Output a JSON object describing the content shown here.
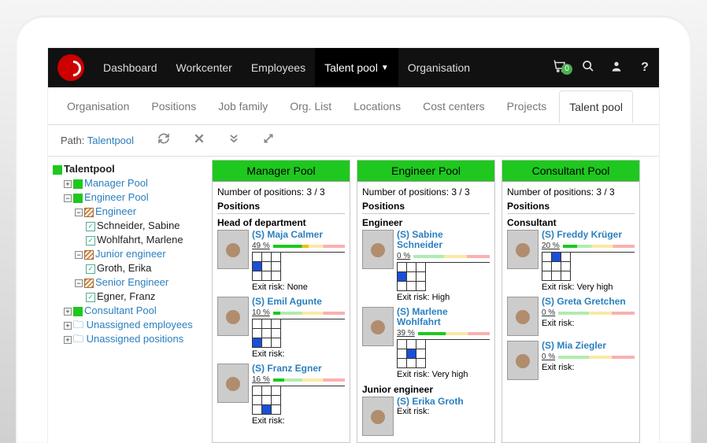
{
  "topnav": {
    "items": [
      "Dashboard",
      "Workcenter",
      "Employees",
      "Talent pool",
      "Organisation"
    ],
    "active_index": 3,
    "cart_count": "0"
  },
  "subtabs": {
    "items": [
      "Organisation",
      "Positions",
      "Job family",
      "Org. List",
      "Locations",
      "Cost centers",
      "Projects",
      "Talent pool"
    ],
    "active_index": 7
  },
  "pathbar": {
    "label": "Path:",
    "link": "Talentpool"
  },
  "tree": {
    "root": "Talentpool",
    "manager_pool": "Manager Pool",
    "engineer_pool": "Engineer Pool",
    "engineer": "Engineer",
    "schneider": "Schneider, Sabine",
    "wohlfahrt": "Wohlfahrt, Marlene",
    "junior_engineer": "Junior engineer",
    "groth": "Groth, Erika",
    "senior_engineer": "Senior Engineer",
    "egner": "Egner, Franz",
    "consultant_pool": "Consultant Pool",
    "unassigned_emp": "Unassigned employees",
    "unassigned_pos": "Unassigned positions"
  },
  "labels": {
    "num_positions": "Number of positions: 3 / 3",
    "positions": "Positions",
    "exit_risk": "Exit risk:"
  },
  "pools": [
    {
      "title": "Manager Pool",
      "roles": [
        {
          "role": "Head of department",
          "employees": [
            {
              "name": "(S) Maja Calmer",
              "pct": "49 %",
              "shade": 51,
              "exit": "None",
              "cell": 3
            },
            {
              "name": "(S) Emil Agunte",
              "pct": "10 %",
              "shade": 90,
              "exit": "",
              "cell": 6
            },
            {
              "name": "(S) Franz Egner",
              "pct": "16 %",
              "shade": 84,
              "exit": "",
              "cell": 7
            }
          ]
        }
      ]
    },
    {
      "title": "Engineer Pool",
      "roles": [
        {
          "role": "Engineer",
          "employees": [
            {
              "name": "(S) Sabine Schneider",
              "pct": "0 %",
              "shade": 100,
              "exit": "High",
              "cell": 3
            },
            {
              "name": "(S) Marlene Wohlfahrt",
              "pct": "39 %",
              "shade": 61,
              "exit": "Very high",
              "cell": 4
            }
          ]
        },
        {
          "role": "Junior engineer",
          "employees": [
            {
              "name": "(S) Erika Groth",
              "pct": "",
              "shade": 100,
              "exit": "",
              "cell": -1
            }
          ]
        }
      ]
    },
    {
      "title": "Consultant Pool",
      "roles": [
        {
          "role": "Consultant",
          "employees": [
            {
              "name": "(S) Freddy Krüger",
              "pct": "20 %",
              "shade": 80,
              "exit": "Very high",
              "cell": 1
            },
            {
              "name": "(S) Greta Gretchen",
              "pct": "0 %",
              "shade": 100,
              "exit": "",
              "cell": -1
            },
            {
              "name": "(S) Mia Ziegler",
              "pct": "0 %",
              "shade": 100,
              "exit": "",
              "cell": -1
            }
          ]
        }
      ]
    }
  ]
}
